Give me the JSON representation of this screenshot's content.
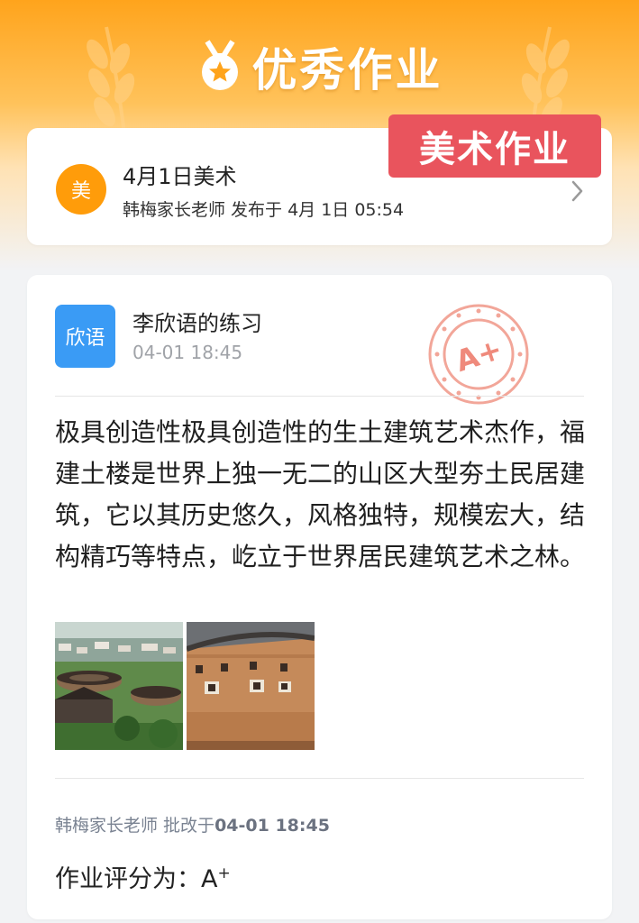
{
  "header": {
    "brand_title": "优秀作业",
    "tag_label": "美术作业"
  },
  "assignment": {
    "subject_badge": "美",
    "title": "4月1日美术",
    "meta": "韩梅家长老师 发布于 4月 1日 05:54"
  },
  "submission": {
    "student_badge": "欣语",
    "student_title": "李欣语的练习",
    "submit_time": "04-01 18:45",
    "grade_stamp": "A+",
    "content": "极具创造性极具创造性的生土建筑艺术杰作，福建土楼是世界上独一无二的山区大型夯土民居建筑，它以其历史悠久，风格独特，规模宏大，结构精巧等特点，屹立于世界居民建筑艺术之林。"
  },
  "review": {
    "teacher": "韩梅家长老师",
    "action": " 批改于",
    "time": "04-01 18:45",
    "score_label": "作业评分为：",
    "score_grade": "A",
    "score_suffix": "+"
  },
  "colors": {
    "header_orange": "#ffa41c",
    "tag_red": "#e9545d",
    "subject_orange": "#ff9c0a",
    "student_blue": "#3a9bf5",
    "stamp_red": "#ef8a7c"
  }
}
